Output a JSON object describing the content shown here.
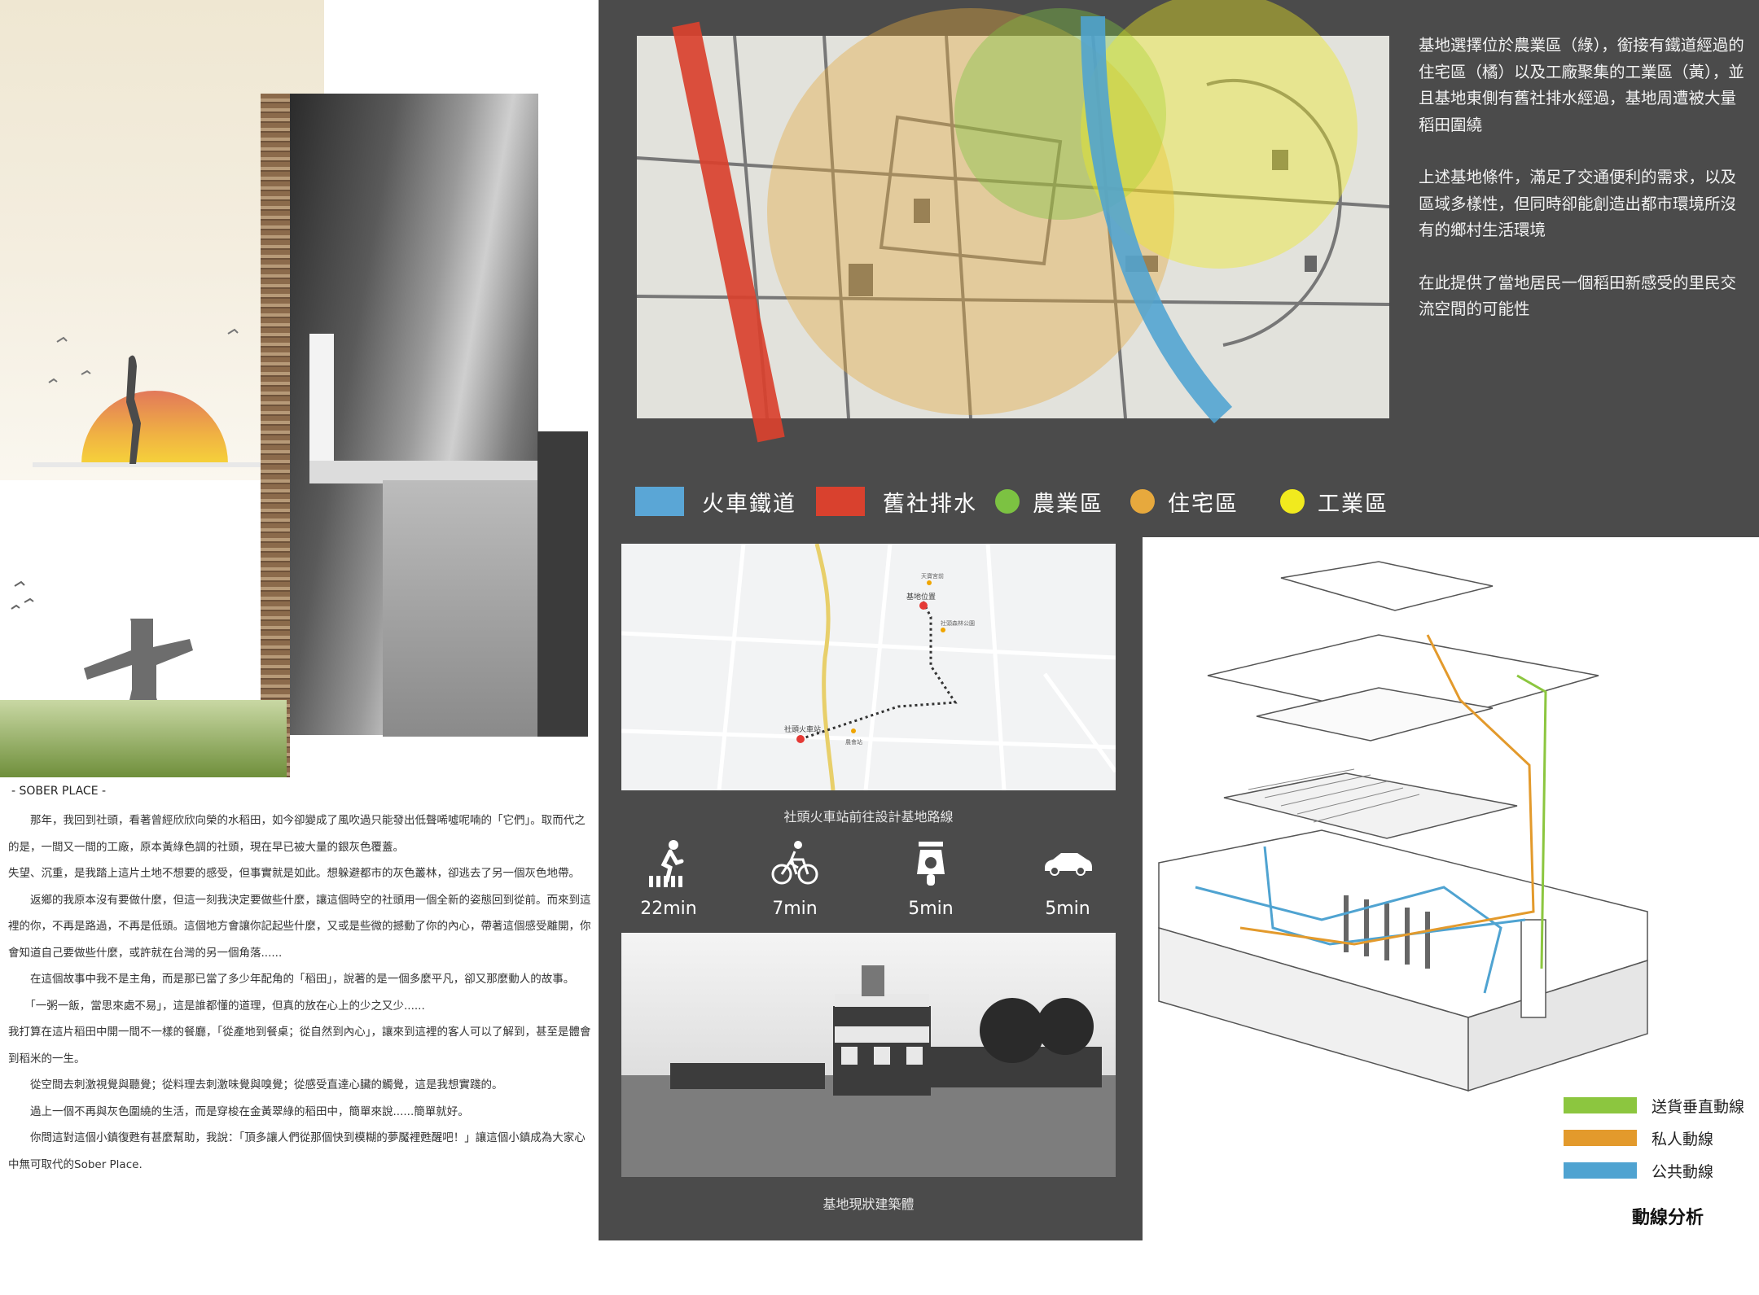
{
  "story": {
    "title": "- SOBER PLACE -",
    "paragraphs": [
      "　　那年，我回到社頭，看著曾經欣欣向榮的水稻田，如今卻變成了風吹過只能發出低聲唏噓呢喃的「它們」。取而代之的是，一間又一間的工廠，原本黃綠色調的社頭，現在早已被大量的銀灰色覆蓋。",
      "失望、沉重，是我踏上這片土地不想要的感受，但事實就是如此。想躲避都市的灰色叢林，卻逃去了另一個灰色地帶。",
      "　　返鄉的我原本沒有要做什麼，但這一刻我決定要做些什麼，讓這個時空的社頭用一個全新的姿態回到從前。而來到這裡的你，不再是路過，不再是低頭。這個地方會讓你記起些什麼，又或是些微的撼動了你的內心，帶著這個感受離開，你會知道自己要做些什麼，或許就在台灣的另一個角落......",
      "　　在這個故事中我不是主角，而是那已當了多少年配角的「稻田」，說著的是一個多麼平凡，卻又那麼動人的故事。",
      "　　「一粥一飯，當思來處不易」，這是誰都懂的道理，但真的放在心上的少之又少......",
      "我打算在這片稻田中開一間不一樣的餐廳，「從產地到餐桌；從自然到內心」，讓來到這裡的客人可以了解到，甚至是體會到稻米的一生。",
      "　　從空間去刺激視覺與聽覺；從料理去刺激味覺與嗅覺；從感受直達心臟的觸覺，這是我想實踐的。",
      "　　過上一個不再與灰色圍繞的生活，而是穿梭在金黃翠綠的稻田中，簡單來說......簡單就好。",
      "　　你問這對這個小鎮復甦有甚麼幫助，我說：「頂多讓人們從那個快到模糊的夢魘裡甦醒吧！」讓這個小鎮成為大家心中無可取代的Sober Place."
    ]
  },
  "site_text": {
    "paragraphs": [
      "基地選擇位於農業區（綠），銜接有鐵道經過的住宅區（橘）以及工廠聚集的工業區（黃），並且基地東側有舊社排水經過，基地周遭被大量稻田圍繞",
      "上述基地條件，滿足了交通便利的需求，以及區域多樣性，但同時卻能創造出都市環境所沒有的鄉村生活環境",
      "在此提供了當地居民一個稻田新感受的里民交流空間的可能性"
    ]
  },
  "legend": {
    "items": [
      {
        "label": "火車鐵道",
        "color": "#5aa6d6",
        "shape": "rect"
      },
      {
        "label": "舊社排水",
        "color": "#d9412e",
        "shape": "rect"
      },
      {
        "label": "農業區",
        "color": "#7cc242",
        "shape": "dot"
      },
      {
        "label": "住宅區",
        "color": "#e7a93d",
        "shape": "dot"
      },
      {
        "label": "工業區",
        "color": "#f1ea1e",
        "shape": "dot"
      }
    ]
  },
  "route_map": {
    "caption": "社頭火車站前往設計基地路線",
    "labels": {
      "station": "社頭火車站",
      "site": "基地位置",
      "poi_top": "天寶宮前",
      "poi_mid": "社頭森林公園",
      "poi_low": "農會站"
    }
  },
  "transport": [
    {
      "icon": "walk-icon",
      "label": "22min"
    },
    {
      "icon": "bicycle-icon",
      "label": "7min"
    },
    {
      "icon": "scooter-icon",
      "label": "5min"
    },
    {
      "icon": "car-icon",
      "label": "5min"
    }
  ],
  "photo": {
    "caption": "基地現狀建築體"
  },
  "circulation": {
    "title": "動線分析",
    "items": [
      {
        "label": "送貨垂直動線",
        "color": "#8cc63f"
      },
      {
        "label": "私人動線",
        "color": "#e39a2c"
      },
      {
        "label": "公共動線",
        "color": "#4fa3d1"
      }
    ]
  },
  "colors": {
    "panel": "#4b4b4b",
    "rail": "#5aa6d6",
    "drain": "#d9412e",
    "agri": "#7cc242",
    "resi": "#e7a93d",
    "ind": "#f1ea1e"
  }
}
